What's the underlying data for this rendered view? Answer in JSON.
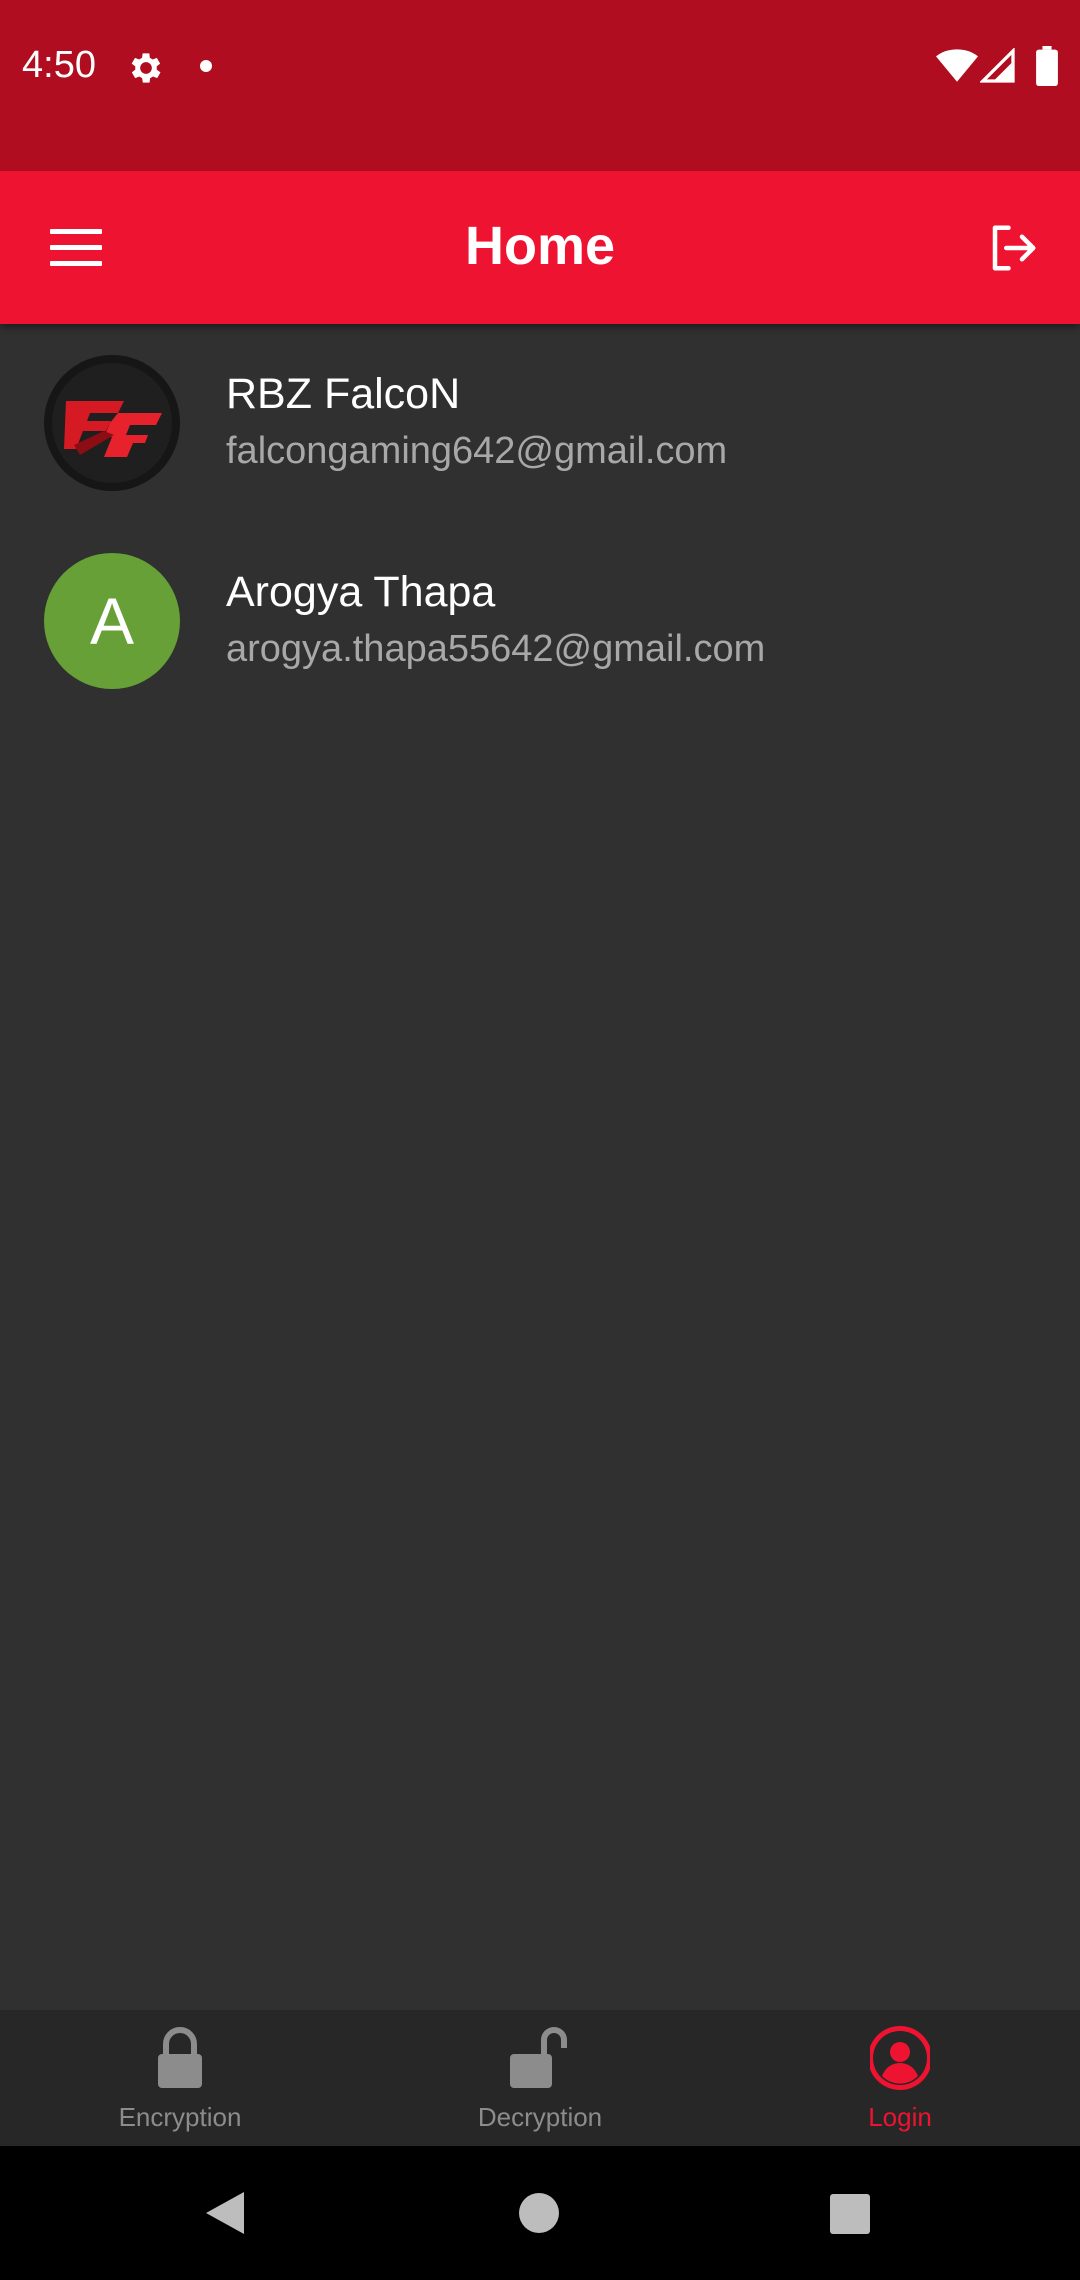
{
  "status_bar": {
    "time": "4:50",
    "icons": [
      "gear-icon",
      "notification-dot-icon",
      "wifi-icon",
      "signal-icon",
      "battery-icon"
    ]
  },
  "app_bar": {
    "title": "Home",
    "left_icon": "menu-icon",
    "right_icon": "logout-icon"
  },
  "accounts": [
    {
      "name": "RBZ FalcoN",
      "email": "falcongaming642@gmail.com",
      "avatar": "logo-image"
    },
    {
      "name": "Arogya Thapa",
      "email": "arogya.thapa55642@gmail.com",
      "avatar_letter": "A"
    }
  ],
  "bottom_nav": {
    "tabs": [
      {
        "label": "Encryption",
        "icon": "lock-icon",
        "active": false
      },
      {
        "label": "Decryption",
        "icon": "unlock-icon",
        "active": false
      },
      {
        "label": "Login",
        "icon": "account-circle-icon",
        "active": true
      }
    ]
  },
  "colors": {
    "status_bar": "#b00d20",
    "app_bar": "#ee1330",
    "background": "#303030",
    "avatar_green": "#66a036",
    "nav_inactive": "#8c8c8c",
    "nav_active": "#ee1330"
  },
  "system_nav": {
    "buttons": [
      "back-icon",
      "home-icon",
      "recents-icon"
    ]
  }
}
